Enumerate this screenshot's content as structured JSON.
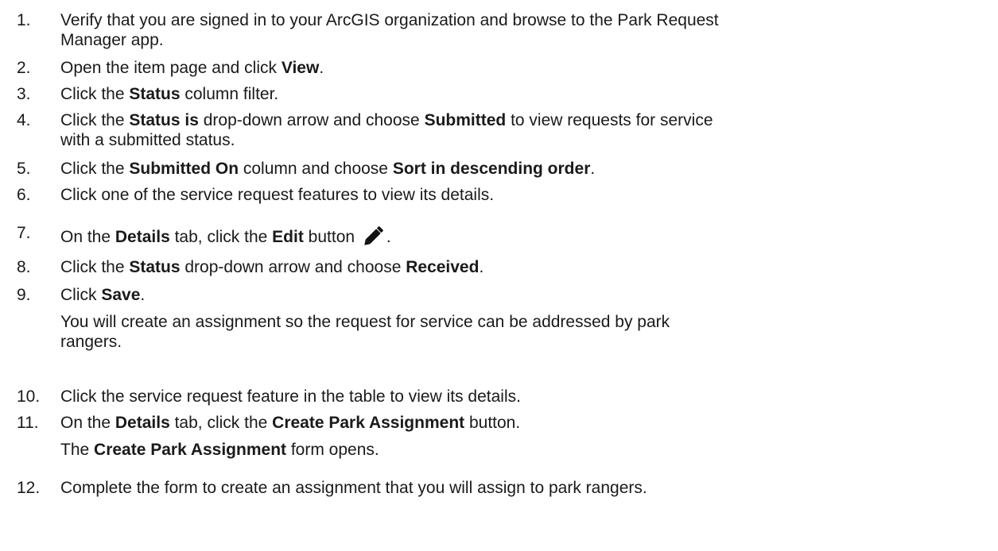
{
  "steps": [
    {
      "number": "1.",
      "lines": [
        [
          {
            "t": " Verify that you are signed in to your ArcGIS organization and browse to the Park Request"
          }
        ],
        [
          {
            "t": "Manager app."
          }
        ]
      ]
    },
    {
      "number": "2.",
      "lines": [
        [
          {
            "t": "Open the item page and click "
          },
          {
            "t": "View",
            "b": true
          },
          {
            "t": "."
          }
        ]
      ]
    },
    {
      "number": "3.",
      "lines": [
        [
          {
            "t": "Click the "
          },
          {
            "t": "Status",
            "b": true
          },
          {
            "t": " column filter."
          }
        ]
      ]
    },
    {
      "number": "4.",
      "lines": [
        [
          {
            "t": "Click the "
          },
          {
            "t": "Status is",
            "b": true
          },
          {
            "t": " drop-down arrow and choose "
          },
          {
            "t": "Submitted",
            "b": true
          },
          {
            "t": " to view requests for service"
          }
        ],
        [
          {
            "t": "with a submitted status."
          }
        ]
      ]
    },
    {
      "number": "5.",
      "lines": [
        [
          {
            "t": "Click the "
          },
          {
            "t": "Submitted On",
            "b": true
          },
          {
            "t": " column and choose "
          },
          {
            "t": "Sort in descending order",
            "b": true
          },
          {
            "t": "."
          }
        ]
      ]
    },
    {
      "number": "6.",
      "lines": [
        [
          {
            "t": "Click one of the service request features to view its details."
          }
        ]
      ]
    },
    {
      "number": "7.",
      "lines": [
        [
          {
            "t": " On the "
          },
          {
            "t": "Details",
            "b": true
          },
          {
            "t": " tab, click the "
          },
          {
            "t": "Edit",
            "b": true
          },
          {
            "t": " button "
          },
          {
            "icon": "pencil-icon"
          },
          {
            "t": "."
          }
        ]
      ]
    },
    {
      "number": "8.",
      "lines": [
        [
          {
            "t": "Click the "
          },
          {
            "t": "Status",
            "b": true
          },
          {
            "t": " drop-down arrow and choose "
          },
          {
            "t": "Received",
            "b": true
          },
          {
            "t": "."
          }
        ]
      ]
    },
    {
      "number": "9.",
      "lines": [
        [
          {
            "t": "Click "
          },
          {
            "t": "Save",
            "b": true
          },
          {
            "t": "."
          }
        ],
        [
          {
            "t": "You will create an assignment so the request for service can be addressed by park"
          }
        ],
        [
          {
            "t": "rangers."
          }
        ]
      ]
    },
    {
      "number": "10.",
      "lines": [
        [
          {
            "t": "Click the service request feature in the table to view its details."
          }
        ]
      ]
    },
    {
      "number": "11.",
      "lines": [
        [
          {
            "t": " On the "
          },
          {
            "t": "Details",
            "b": true
          },
          {
            "t": " tab, click the "
          },
          {
            "t": "Create Park Assignment",
            "b": true
          },
          {
            "t": " button."
          }
        ],
        [
          {
            "t": "The "
          },
          {
            "t": "Create Park Assignment",
            "b": true
          },
          {
            "t": " form opens."
          }
        ]
      ]
    },
    {
      "number": "12.",
      "lines": [
        [
          {
            "t": "Complete the form to create an assignment that you will assign to park rangers."
          }
        ]
      ]
    }
  ]
}
